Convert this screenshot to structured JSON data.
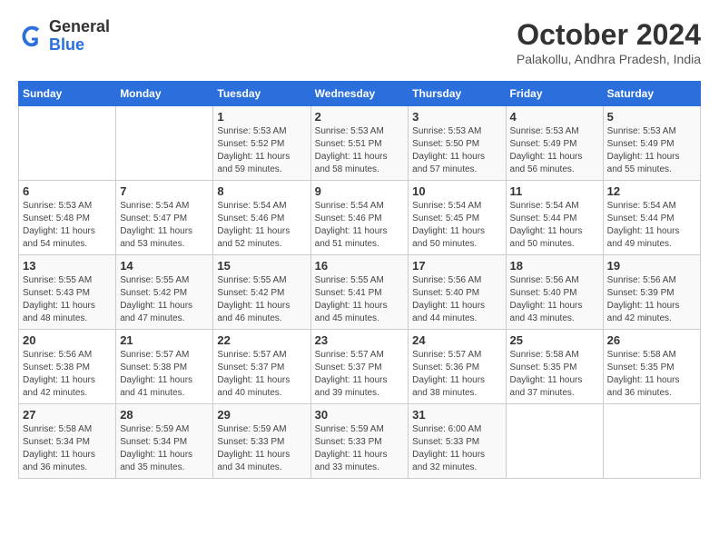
{
  "logo": {
    "line1": "General",
    "line2": "Blue"
  },
  "title": "October 2024",
  "location": "Palakollu, Andhra Pradesh, India",
  "days_of_week": [
    "Sunday",
    "Monday",
    "Tuesday",
    "Wednesday",
    "Thursday",
    "Friday",
    "Saturday"
  ],
  "weeks": [
    [
      {
        "day": "",
        "info": ""
      },
      {
        "day": "",
        "info": ""
      },
      {
        "day": "1",
        "info": "Sunrise: 5:53 AM\nSunset: 5:52 PM\nDaylight: 11 hours and 59 minutes."
      },
      {
        "day": "2",
        "info": "Sunrise: 5:53 AM\nSunset: 5:51 PM\nDaylight: 11 hours and 58 minutes."
      },
      {
        "day": "3",
        "info": "Sunrise: 5:53 AM\nSunset: 5:50 PM\nDaylight: 11 hours and 57 minutes."
      },
      {
        "day": "4",
        "info": "Sunrise: 5:53 AM\nSunset: 5:49 PM\nDaylight: 11 hours and 56 minutes."
      },
      {
        "day": "5",
        "info": "Sunrise: 5:53 AM\nSunset: 5:49 PM\nDaylight: 11 hours and 55 minutes."
      }
    ],
    [
      {
        "day": "6",
        "info": "Sunrise: 5:53 AM\nSunset: 5:48 PM\nDaylight: 11 hours and 54 minutes."
      },
      {
        "day": "7",
        "info": "Sunrise: 5:54 AM\nSunset: 5:47 PM\nDaylight: 11 hours and 53 minutes."
      },
      {
        "day": "8",
        "info": "Sunrise: 5:54 AM\nSunset: 5:46 PM\nDaylight: 11 hours and 52 minutes."
      },
      {
        "day": "9",
        "info": "Sunrise: 5:54 AM\nSunset: 5:46 PM\nDaylight: 11 hours and 51 minutes."
      },
      {
        "day": "10",
        "info": "Sunrise: 5:54 AM\nSunset: 5:45 PM\nDaylight: 11 hours and 50 minutes."
      },
      {
        "day": "11",
        "info": "Sunrise: 5:54 AM\nSunset: 5:44 PM\nDaylight: 11 hours and 50 minutes."
      },
      {
        "day": "12",
        "info": "Sunrise: 5:54 AM\nSunset: 5:44 PM\nDaylight: 11 hours and 49 minutes."
      }
    ],
    [
      {
        "day": "13",
        "info": "Sunrise: 5:55 AM\nSunset: 5:43 PM\nDaylight: 11 hours and 48 minutes."
      },
      {
        "day": "14",
        "info": "Sunrise: 5:55 AM\nSunset: 5:42 PM\nDaylight: 11 hours and 47 minutes."
      },
      {
        "day": "15",
        "info": "Sunrise: 5:55 AM\nSunset: 5:42 PM\nDaylight: 11 hours and 46 minutes."
      },
      {
        "day": "16",
        "info": "Sunrise: 5:55 AM\nSunset: 5:41 PM\nDaylight: 11 hours and 45 minutes."
      },
      {
        "day": "17",
        "info": "Sunrise: 5:56 AM\nSunset: 5:40 PM\nDaylight: 11 hours and 44 minutes."
      },
      {
        "day": "18",
        "info": "Sunrise: 5:56 AM\nSunset: 5:40 PM\nDaylight: 11 hours and 43 minutes."
      },
      {
        "day": "19",
        "info": "Sunrise: 5:56 AM\nSunset: 5:39 PM\nDaylight: 11 hours and 42 minutes."
      }
    ],
    [
      {
        "day": "20",
        "info": "Sunrise: 5:56 AM\nSunset: 5:38 PM\nDaylight: 11 hours and 42 minutes."
      },
      {
        "day": "21",
        "info": "Sunrise: 5:57 AM\nSunset: 5:38 PM\nDaylight: 11 hours and 41 minutes."
      },
      {
        "day": "22",
        "info": "Sunrise: 5:57 AM\nSunset: 5:37 PM\nDaylight: 11 hours and 40 minutes."
      },
      {
        "day": "23",
        "info": "Sunrise: 5:57 AM\nSunset: 5:37 PM\nDaylight: 11 hours and 39 minutes."
      },
      {
        "day": "24",
        "info": "Sunrise: 5:57 AM\nSunset: 5:36 PM\nDaylight: 11 hours and 38 minutes."
      },
      {
        "day": "25",
        "info": "Sunrise: 5:58 AM\nSunset: 5:35 PM\nDaylight: 11 hours and 37 minutes."
      },
      {
        "day": "26",
        "info": "Sunrise: 5:58 AM\nSunset: 5:35 PM\nDaylight: 11 hours and 36 minutes."
      }
    ],
    [
      {
        "day": "27",
        "info": "Sunrise: 5:58 AM\nSunset: 5:34 PM\nDaylight: 11 hours and 36 minutes."
      },
      {
        "day": "28",
        "info": "Sunrise: 5:59 AM\nSunset: 5:34 PM\nDaylight: 11 hours and 35 minutes."
      },
      {
        "day": "29",
        "info": "Sunrise: 5:59 AM\nSunset: 5:33 PM\nDaylight: 11 hours and 34 minutes."
      },
      {
        "day": "30",
        "info": "Sunrise: 5:59 AM\nSunset: 5:33 PM\nDaylight: 11 hours and 33 minutes."
      },
      {
        "day": "31",
        "info": "Sunrise: 6:00 AM\nSunset: 5:33 PM\nDaylight: 11 hours and 32 minutes."
      },
      {
        "day": "",
        "info": ""
      },
      {
        "day": "",
        "info": ""
      }
    ]
  ]
}
